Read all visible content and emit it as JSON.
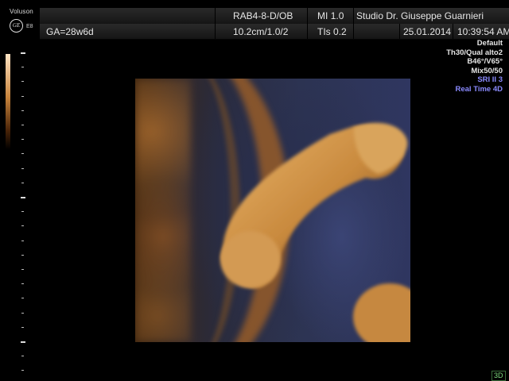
{
  "brand": {
    "logo_text": "Voluson",
    "ge_mark": "GE",
    "model": "E8"
  },
  "header": {
    "row1": {
      "probe": "RAB4-8-D/OB",
      "mi_label": "MI",
      "mi_value": "1.0",
      "clinic": "Studio Dr. Giuseppe Guarnieri"
    },
    "row2": {
      "ga": "GA=28w6d",
      "depth": "10.2cm/1.0/2",
      "tis_label": "TIs",
      "tis_value": "0.2",
      "date": "25.01.2014",
      "time": "10:39:54 AM"
    }
  },
  "settings": [
    {
      "text": "Default",
      "color": "#e6e6e6"
    },
    {
      "text": "Th30/Qual alto2",
      "color": "#e6e6e6"
    },
    {
      "text": "B46°/V65°",
      "color": "#e6e6e6"
    },
    {
      "text": "Mix50/50",
      "color": "#e6e6e6"
    },
    {
      "text": "SRI II 3",
      "color": "#8a8aff"
    },
    {
      "text": "Real Time 4D",
      "color": "#8a8aff"
    }
  ],
  "mode_badge": "3D",
  "icons": {
    "logo": "ge-logo-icon"
  }
}
